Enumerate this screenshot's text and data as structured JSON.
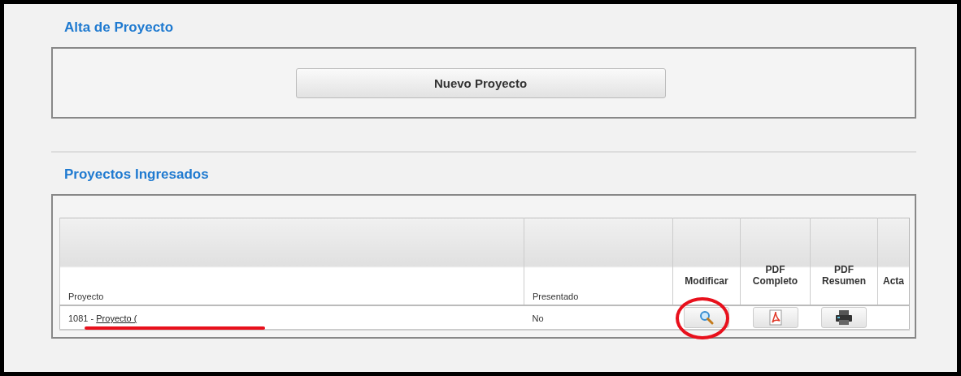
{
  "alta": {
    "title": "Alta de Proyecto",
    "button": "Nuevo Proyecto"
  },
  "ingresados": {
    "title": "Proyectos Ingresados",
    "columns": [
      "Proyecto",
      "Presentado",
      "Modificar",
      "PDF Completo",
      "PDF Resumen",
      "Acta"
    ],
    "rows": [
      {
        "id": "1081 -",
        "name": "Proyecto (",
        "presentado": "No",
        "name_underlined": true,
        "modify_circled": true
      }
    ]
  }
}
